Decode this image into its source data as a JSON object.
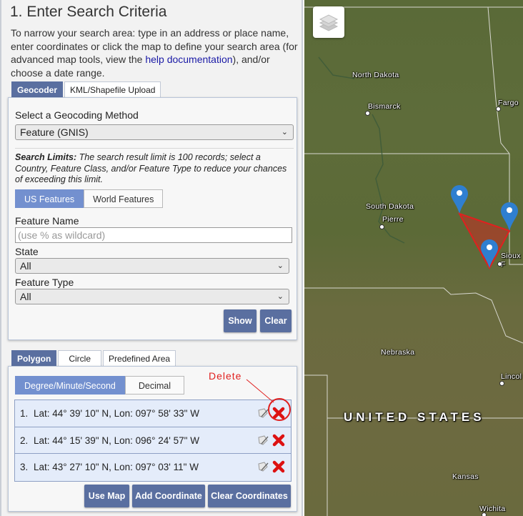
{
  "panel": {
    "title": "1. Enter Search Criteria",
    "intro_part1": "To narrow your search area: type in an address or place name, enter coordinates or click the map to define your search area (for advanced map tools, view the ",
    "intro_link": "help documentation",
    "intro_part2": "), and/or choose a date range.",
    "top_tabs": [
      {
        "label": "Geocoder",
        "active": true
      },
      {
        "label": "KML/Shapefile Upload",
        "active": false
      }
    ],
    "geocoder": {
      "method_label": "Select a Geocoding Method",
      "method_value": "Feature (GNIS)",
      "search_limits_bold": "Search Limits:",
      "search_limits_text": " The search result limit is 100 records; select a Country, Feature Class, and/or Feature Type to reduce your chances of exceeding this limit.",
      "feature_tabs": [
        {
          "label": "US Features",
          "active": true
        },
        {
          "label": "World Features",
          "active": false
        }
      ],
      "feature_name_label": "Feature Name",
      "feature_name_placeholder": "(use % as wildcard)",
      "feature_name_value": "",
      "state_label": "State",
      "state_value": "All",
      "feature_type_label": "Feature Type",
      "feature_type_value": "All",
      "show_button": "Show",
      "clear_button": "Clear"
    },
    "area_tabs": [
      {
        "label": "Polygon",
        "active": true
      },
      {
        "label": "Circle",
        "active": false
      },
      {
        "label": "Predefined Area",
        "active": false
      }
    ],
    "polygon": {
      "format_tabs": [
        {
          "label": "Degree/Minute/Second",
          "active": true
        },
        {
          "label": "Decimal",
          "active": false
        }
      ],
      "coordinates": [
        {
          "num": "1.",
          "text": "Lat: 44° 39' 10\" N, Lon: 097° 58' 33\" W"
        },
        {
          "num": "2.",
          "text": "Lat: 44° 15' 39\" N, Lon: 096° 24' 57\" W"
        },
        {
          "num": "3.",
          "text": "Lat: 43° 27' 10\" N, Lon: 097° 03' 11\" W"
        }
      ],
      "use_map_button": "Use Map",
      "add_coordinate_button": "Add Coordinate",
      "clear_coordinates_button": "Clear Coordinates"
    },
    "annotation": "Delete"
  },
  "map": {
    "layers_icon": "layers-icon",
    "labels": [
      {
        "id": "north-dakota",
        "text": "North Dakota"
      },
      {
        "id": "bismarck",
        "text": "Bismarck"
      },
      {
        "id": "fargo",
        "text": "Fargo"
      },
      {
        "id": "south-dakota",
        "text": "South Dakota"
      },
      {
        "id": "pierre",
        "text": "Pierre"
      },
      {
        "id": "sioux-falls",
        "text": "Sioux F"
      },
      {
        "id": "nebraska",
        "text": "Nebraska"
      },
      {
        "id": "lincoln",
        "text": "Lincol"
      },
      {
        "id": "kansas",
        "text": "Kansas"
      },
      {
        "id": "wichita",
        "text": "Wichita"
      }
    ],
    "country_label": "UNITED STATES",
    "polygon_color": "#e0201f",
    "pin_color": "#2f7fd0",
    "marker_count": 3
  }
}
